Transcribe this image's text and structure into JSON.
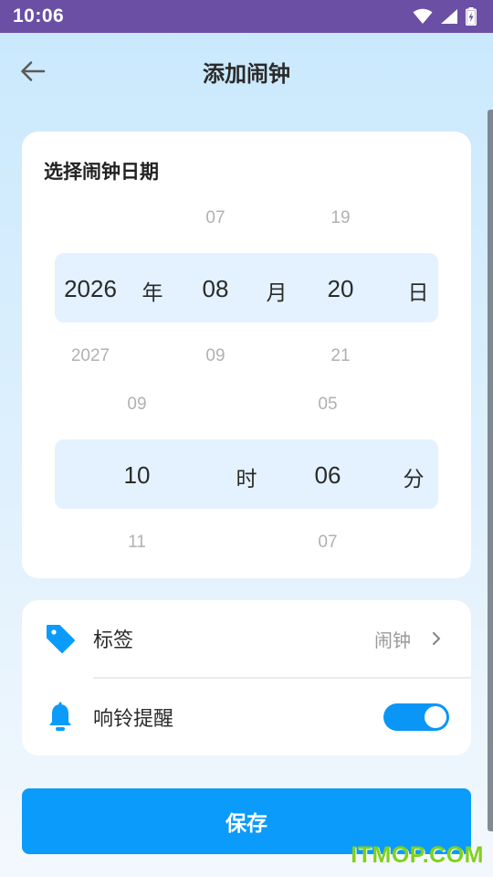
{
  "status_bar": {
    "time": "10:06"
  },
  "app_bar": {
    "title": "添加闹钟"
  },
  "date_card": {
    "title": "选择闹钟日期",
    "date_picker": {
      "year": {
        "above": "",
        "selected": "2026",
        "below": "2027",
        "unit": "年"
      },
      "month": {
        "above": "07",
        "selected": "08",
        "below": "09",
        "unit": "月"
      },
      "day": {
        "above": "19",
        "selected": "20",
        "below": "21",
        "unit": "日"
      }
    },
    "time_picker": {
      "hour": {
        "above": "09",
        "selected": "10",
        "below": "11",
        "unit": "时"
      },
      "minute": {
        "above": "05",
        "selected": "06",
        "below": "07",
        "unit": "分"
      }
    }
  },
  "settings": {
    "tag": {
      "label": "标签",
      "value": "闹钟",
      "icon": "tag-icon"
    },
    "ring": {
      "label": "响铃提醒",
      "icon": "bell-icon",
      "enabled": true
    }
  },
  "save_button": {
    "label": "保存"
  },
  "watermark": {
    "text": "ITMOP.COM"
  },
  "colors": {
    "status_bar": "#6a4fa4",
    "accent": "#0a9bfb",
    "picker_band": "#e3f2fe",
    "watermark": "#7fd11c"
  }
}
